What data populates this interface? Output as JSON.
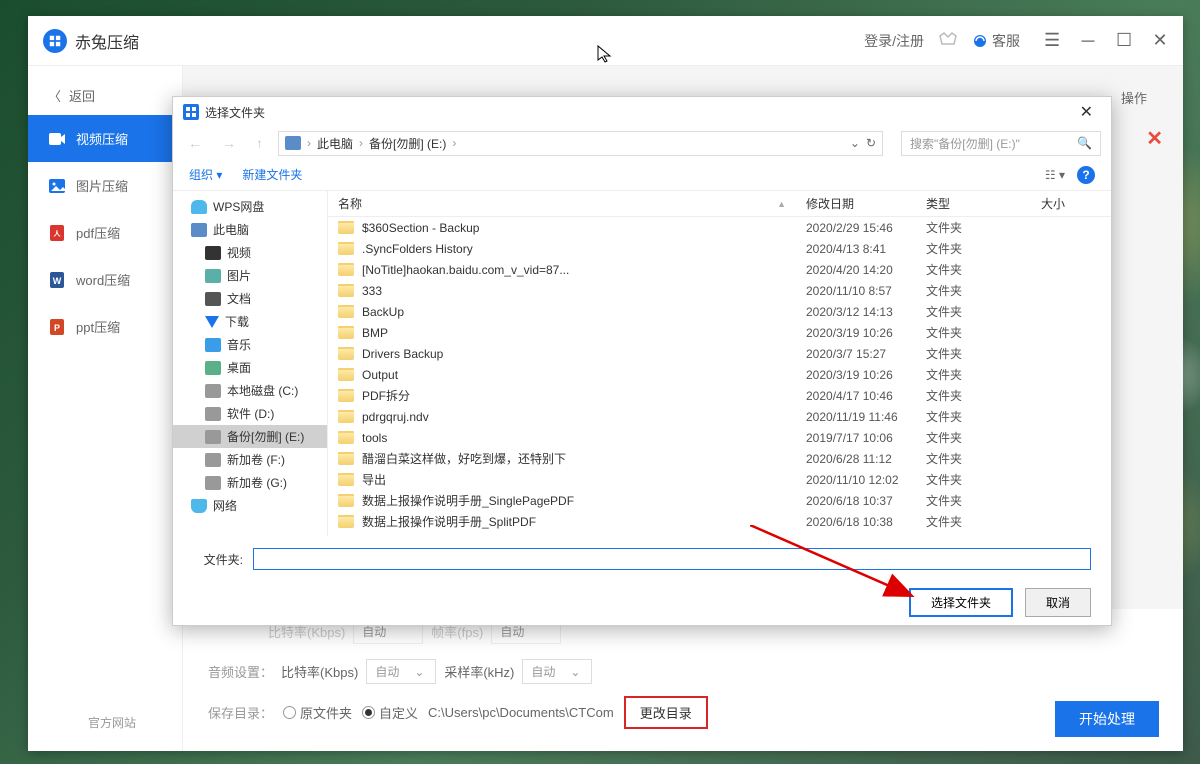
{
  "app": {
    "title": "赤兔压缩"
  },
  "titlebar": {
    "login": "登录/注册",
    "vip": "VIP",
    "customer_service": "客服"
  },
  "sidebar": {
    "back": "返回",
    "items": [
      {
        "label": "视频压缩"
      },
      {
        "label": "图片压缩"
      },
      {
        "label": "pdf压缩"
      },
      {
        "label": "word压缩"
      },
      {
        "label": "ppt压缩"
      }
    ],
    "footer": "官方网站"
  },
  "content": {
    "ops_header": "操作",
    "partial": {
      "bitrate_label": "比特率(Kbps)",
      "bitrate_val": "自动",
      "fps_label": "帧率(fps)",
      "fps_val": "自动"
    },
    "audio": {
      "label": "音频设置：",
      "bitrate_label": "比特率(Kbps)",
      "bitrate_val": "自动",
      "sample_label": "采样率(kHz)",
      "sample_val": "自动"
    },
    "save": {
      "label": "保存目录：",
      "orig": "原文件夹",
      "custom": "自定义",
      "path": "C:\\Users\\pc\\Documents\\CTCom",
      "change": "更改目录"
    },
    "start": "开始处理"
  },
  "dialog": {
    "title": "选择文件夹",
    "breadcrumb": {
      "this_pc": "此电脑",
      "drive": "备份[勿删] (E:)"
    },
    "search_placeholder": "搜索\"备份[勿删] (E:)\"",
    "toolbar": {
      "organize": "组织",
      "new_folder": "新建文件夹"
    },
    "tree": [
      {
        "label": "WPS网盘",
        "icon": "ic-cloud"
      },
      {
        "label": "此电脑",
        "icon": "ic-pc"
      },
      {
        "label": "视频",
        "icon": "ic-vid",
        "sub": true
      },
      {
        "label": "图片",
        "icon": "ic-pic",
        "sub": true
      },
      {
        "label": "文档",
        "icon": "ic-doc",
        "sub": true
      },
      {
        "label": "下载",
        "icon": "ic-dl",
        "sub": true
      },
      {
        "label": "音乐",
        "icon": "ic-music",
        "sub": true
      },
      {
        "label": "桌面",
        "icon": "ic-desk",
        "sub": true
      },
      {
        "label": "本地磁盘 (C:)",
        "icon": "ic-disk",
        "sub": true
      },
      {
        "label": "软件 (D:)",
        "icon": "ic-disk",
        "sub": true
      },
      {
        "label": "备份[勿删] (E:)",
        "icon": "ic-disk",
        "sub": true,
        "selected": true
      },
      {
        "label": "新加卷 (F:)",
        "icon": "ic-disk",
        "sub": true
      },
      {
        "label": "新加卷 (G:)",
        "icon": "ic-disk",
        "sub": true
      },
      {
        "label": "网络",
        "icon": "ic-net"
      }
    ],
    "columns": {
      "name": "名称",
      "date": "修改日期",
      "type": "类型",
      "size": "大小"
    },
    "files": [
      {
        "name": "$360Section - Backup",
        "date": "2020/2/29 15:46",
        "type": "文件夹"
      },
      {
        "name": ".SyncFolders History",
        "date": "2020/4/13 8:41",
        "type": "文件夹"
      },
      {
        "name": "[NoTitle]haokan.baidu.com_v_vid=87...",
        "date": "2020/4/20 14:20",
        "type": "文件夹"
      },
      {
        "name": "333",
        "date": "2020/11/10 8:57",
        "type": "文件夹"
      },
      {
        "name": "BackUp",
        "date": "2020/3/12 14:13",
        "type": "文件夹"
      },
      {
        "name": "BMP",
        "date": "2020/3/19 10:26",
        "type": "文件夹"
      },
      {
        "name": "Drivers Backup",
        "date": "2020/3/7 15:27",
        "type": "文件夹"
      },
      {
        "name": "Output",
        "date": "2020/3/19 10:26",
        "type": "文件夹"
      },
      {
        "name": "PDF拆分",
        "date": "2020/4/17 10:46",
        "type": "文件夹"
      },
      {
        "name": "pdrgqruj.ndv",
        "date": "2020/11/19 11:46",
        "type": "文件夹"
      },
      {
        "name": "tools",
        "date": "2019/7/17 10:06",
        "type": "文件夹"
      },
      {
        "name": "醋溜白菜这样做，好吃到爆，还特别下",
        "date": "2020/6/28 11:12",
        "type": "文件夹"
      },
      {
        "name": "导出",
        "date": "2020/11/10 12:02",
        "type": "文件夹"
      },
      {
        "name": "数据上报操作说明手册_SinglePagePDF",
        "date": "2020/6/18 10:37",
        "type": "文件夹"
      },
      {
        "name": "数据上报操作说明手册_SplitPDF",
        "date": "2020/6/18 10:38",
        "type": "文件夹"
      }
    ],
    "folder_label": "文件夹:",
    "folder_value": "",
    "select_btn": "选择文件夹",
    "cancel_btn": "取消"
  }
}
